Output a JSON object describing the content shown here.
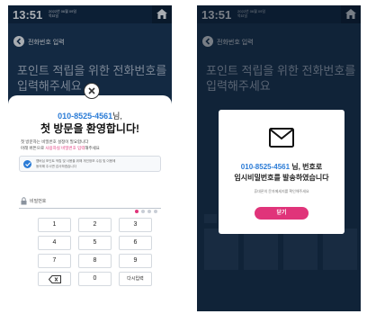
{
  "status": {
    "time": "13:51",
    "date_line1": "2022년 06월 09일",
    "date_line2": "목요일"
  },
  "header": {
    "back_label": "전화번호 입력"
  },
  "page": {
    "title_line1": "포인트 적립을 위한 전화번호를",
    "title_line2": "입력해주세요"
  },
  "welcome_modal": {
    "phone": "010-8525-4561",
    "phone_suffix": "님,",
    "heading": "첫 방문을 환영합니다!",
    "info_line1": "첫 방문자는 비밀번호 설정이 필요합니다",
    "info_line2_pre": "아래 버튼으로 ",
    "info_line2_pink": "사용하실 비밀번호 입력",
    "info_line2_post": "해주세요",
    "notice_line1": "멤버십 포인트 적립 및 사용을 위해 개인정보 수집 및 이용에",
    "notice_line2": "동의해 주시면 감사하겠습니다",
    "password_label": "비밀번호",
    "password_progress": "1 / 4",
    "keys": [
      "1",
      "2",
      "3",
      "4",
      "5",
      "6",
      "7",
      "8",
      "9",
      "",
      "0",
      "다시입력"
    ]
  },
  "sent_modal": {
    "icon": "mail-icon",
    "phone": "010-8525-4561",
    "line1_suffix": " 님, 번호로",
    "line2": "임시비밀번호를 발송하였습니다",
    "sub": "휴대폰의 문자메세지를 확인해주세요",
    "confirm_label": "닫기"
  },
  "colors": {
    "accent_pink": "#e0347a",
    "accent_blue": "#2a7bd6",
    "screen_bg": "#1a3553"
  }
}
